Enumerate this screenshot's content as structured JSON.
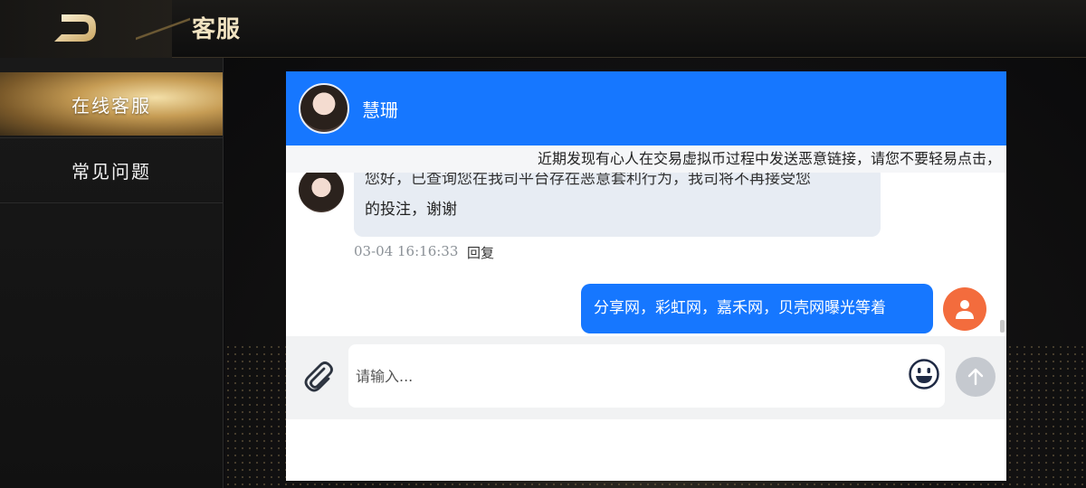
{
  "header": {
    "title": "客服"
  },
  "sidebar": {
    "items": [
      {
        "label": "在线客服",
        "active": true
      },
      {
        "label": "常见问题",
        "active": false
      }
    ]
  },
  "chat": {
    "agent_name": "慧珊",
    "notice": "近期发现有心人在交易虚拟币过程中发送恶意链接，请您不要轻易点击，",
    "messages": [
      {
        "from": "agent",
        "text_line1": "您好，已查询您在我司平台存在恶意套利行为，我司将不再接受您",
        "text_line2": "的投注，谢谢",
        "time": "03-04 16:16:33",
        "reply_label": "回复"
      },
      {
        "from": "user",
        "text": "分享网，彩虹网，嘉禾网，贝壳网曝光等着"
      }
    ],
    "composer": {
      "placeholder": "请输入..."
    }
  },
  "colors": {
    "accent": "#1677ff",
    "user_avatar": "#f36c3d",
    "gold": "#c69c54"
  },
  "icons": [
    "back-icon",
    "paperclip-icon",
    "emoji-icon",
    "arrow-up-icon",
    "user-icon"
  ]
}
